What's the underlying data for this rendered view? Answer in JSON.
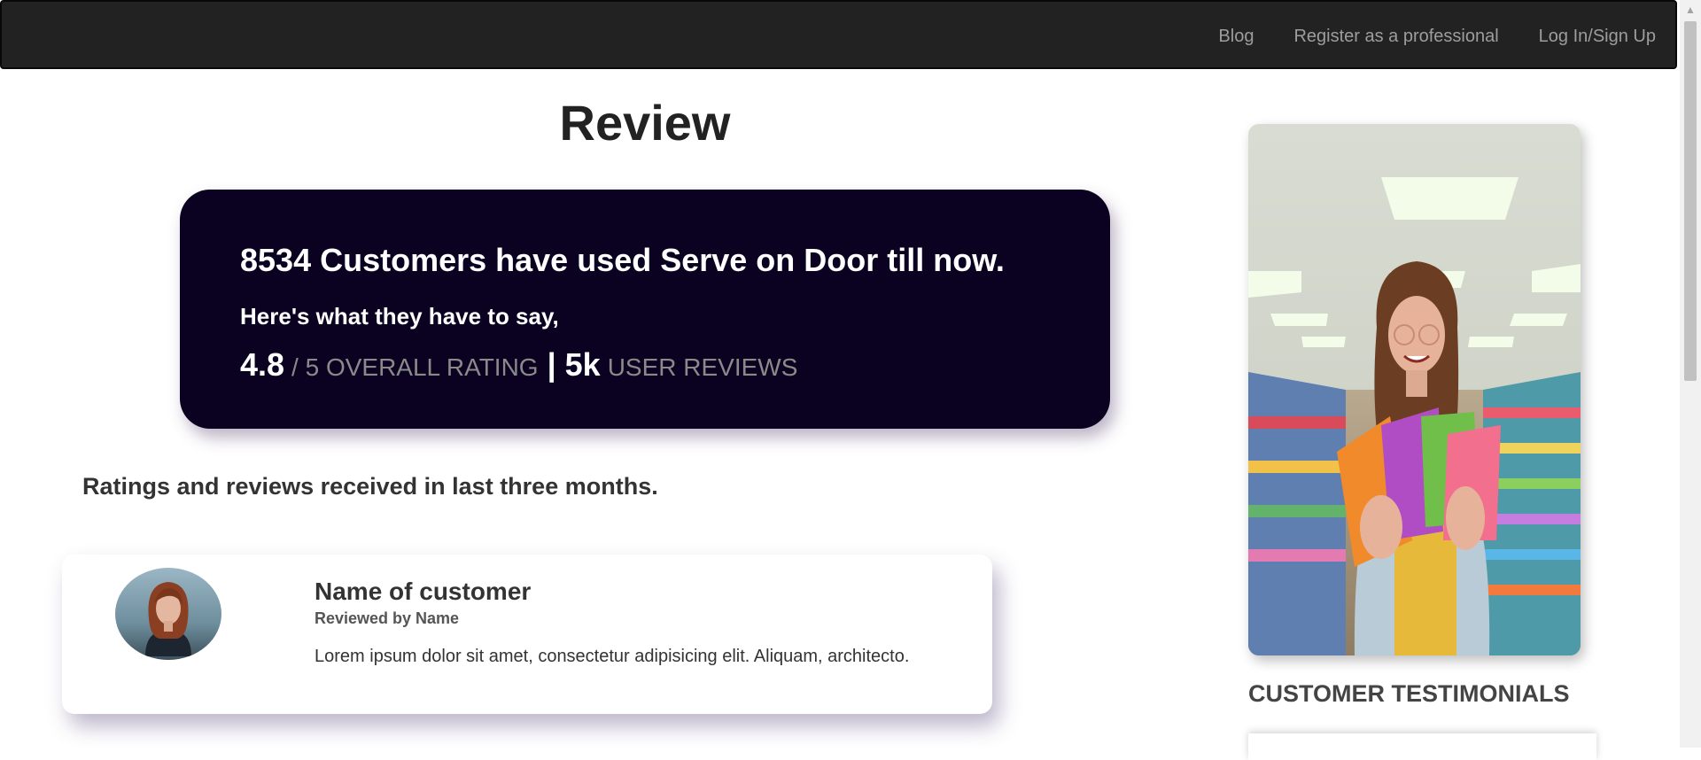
{
  "navbar": {
    "links": [
      "Blog",
      "Register as a professional",
      "Log In/Sign Up"
    ]
  },
  "page": {
    "title": "Review"
  },
  "hero": {
    "headline": "8534 Customers have used Serve on Door till now.",
    "subline": "Here's what they have to say,",
    "rating_value": "4.8",
    "rating_label": "/ 5 OVERALL RATING",
    "separator": "|",
    "reviews_value": "5k",
    "reviews_label": "USER REVIEWS",
    "background_color": "#0a0220"
  },
  "reviews_section": {
    "heading": "Ratings and reviews received in last three months.",
    "cards": [
      {
        "name": "Name of customer",
        "reviewed_by": "Reviewed by Name",
        "text": "Lorem ipsum dolor sit amet, consectetur adipisicing elit. Aliquam, architecto."
      }
    ]
  },
  "sidebar": {
    "testimonials_heading": "CUSTOMER TESTIMONIALS"
  },
  "icons": {
    "scroll_up": "triangle-up-icon"
  }
}
